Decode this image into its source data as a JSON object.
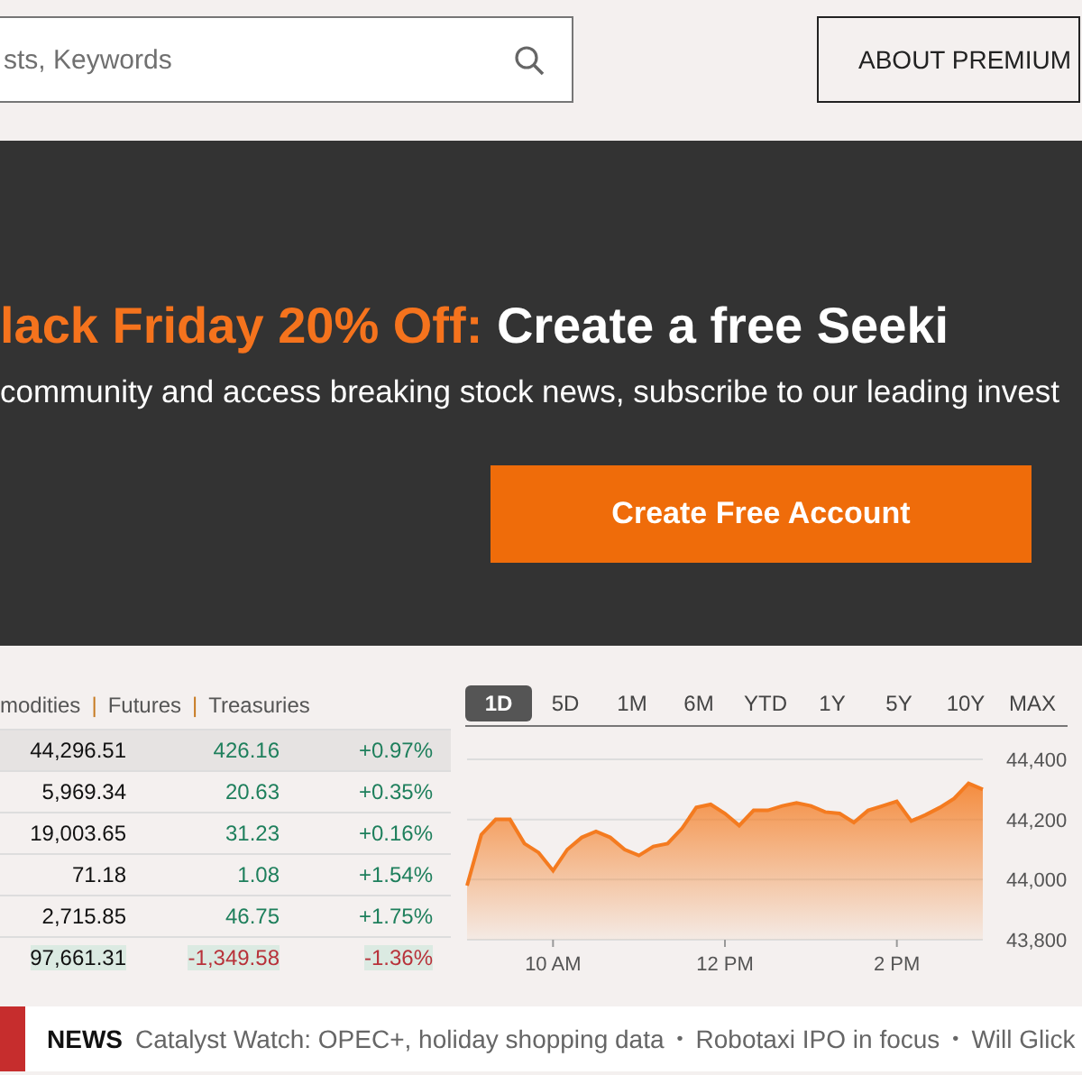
{
  "search": {
    "placeholder": "sts, Keywords"
  },
  "premium_button": "ABOUT PREMIUM",
  "banner": {
    "promo": "lack Friday 20% Off:",
    "headline": "Create a free Seeki",
    "subtext": "community and access breaking stock news, subscribe to our leading invest",
    "button": "Create Free Account"
  },
  "market_tabs": [
    {
      "kind": "tab",
      "label": "modities"
    },
    {
      "kind": "separator",
      "label": "|"
    },
    {
      "kind": "tab",
      "label": "Futures"
    },
    {
      "kind": "separator",
      "label": "|"
    },
    {
      "kind": "tab",
      "label": "Treasuries"
    }
  ],
  "market_rows": [
    {
      "price": "44,296.51",
      "change": "426.16",
      "percent": "+0.97%",
      "negative": false,
      "selected": true,
      "flash": false
    },
    {
      "price": "5,969.34",
      "change": "20.63",
      "percent": "+0.35%",
      "negative": false,
      "selected": false,
      "flash": false
    },
    {
      "price": "19,003.65",
      "change": "31.23",
      "percent": "+0.16%",
      "negative": false,
      "selected": false,
      "flash": false
    },
    {
      "price": "71.18",
      "change": "1.08",
      "percent": "+1.54%",
      "negative": false,
      "selected": false,
      "flash": false
    },
    {
      "price": "2,715.85",
      "change": "46.75",
      "percent": "+1.75%",
      "negative": false,
      "selected": false,
      "flash": false
    },
    {
      "price": "97,661.31",
      "change": "-1,349.58",
      "percent": "-1.36%",
      "negative": true,
      "selected": false,
      "flash": true
    }
  ],
  "periods": [
    {
      "label": "1D",
      "selected": true
    },
    {
      "label": "5D",
      "selected": false
    },
    {
      "label": "1M",
      "selected": false
    },
    {
      "label": "6M",
      "selected": false
    },
    {
      "label": "YTD",
      "selected": false
    },
    {
      "label": "1Y",
      "selected": false
    },
    {
      "label": "5Y",
      "selected": false
    },
    {
      "label": "10Y",
      "selected": false
    },
    {
      "label": "MAX",
      "selected": false
    }
  ],
  "chart": {
    "chart_data": {
      "type": "area",
      "categories": [
        null,
        null,
        null,
        null,
        null,
        null,
        "10 AM",
        null,
        null,
        null,
        null,
        null,
        null,
        null,
        null,
        null,
        null,
        null,
        "12 PM",
        null,
        null,
        null,
        null,
        null,
        null,
        null,
        null,
        null,
        null,
        null,
        "2 PM",
        null,
        null,
        null,
        null,
        null,
        null
      ],
      "series": [
        {
          "color": "#f47b20",
          "values": [
            43980,
            44150,
            44200,
            44200,
            44120,
            44090,
            44030,
            44100,
            44140,
            44160,
            44140,
            44100,
            44080,
            44110,
            44120,
            44170,
            44240,
            44250,
            44220,
            44180,
            44230,
            44230,
            44245,
            44255,
            44245,
            44225,
            44220,
            44190,
            44230,
            44245,
            44260,
            44195,
            44215,
            44240,
            44270,
            44320,
            44300
          ]
        }
      ],
      "ylim": [
        43800,
        44400
      ],
      "yticks": [
        {
          "value": 44400,
          "label": "44,400"
        },
        {
          "value": 44200,
          "label": "44,200"
        },
        {
          "value": 44000,
          "label": "44,000"
        },
        {
          "value": 43800,
          "label": "43,800"
        }
      ]
    }
  },
  "news": {
    "label": "NEWS",
    "items": [
      {
        "kind": "headline",
        "text": "Catalyst Watch: OPEC+, holiday shopping data"
      },
      {
        "kind": "bullet",
        "text": "•"
      },
      {
        "kind": "headline",
        "text": "Robotaxi IPO in focus"
      },
      {
        "kind": "bullet",
        "text": "•"
      },
      {
        "kind": "headline",
        "text": "Will Glick"
      }
    ]
  }
}
